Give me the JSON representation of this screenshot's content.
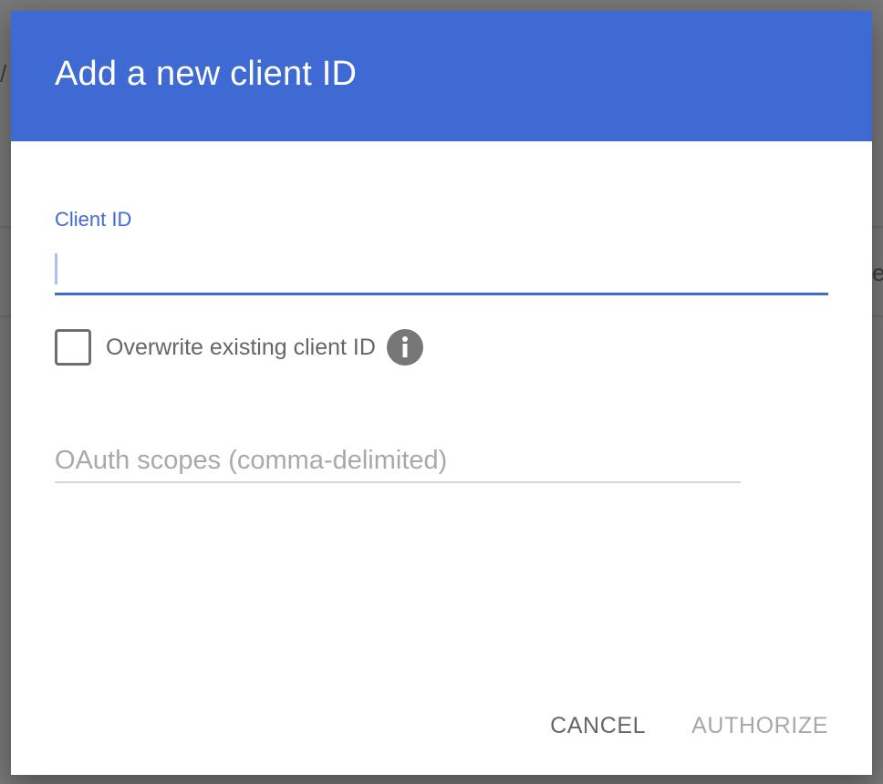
{
  "background": {
    "fragment_left": "/",
    "fragment_right": "es"
  },
  "dialog": {
    "title": "Add a new client ID",
    "header_color": "#3f6ad4",
    "client_id": {
      "label": "Client ID",
      "value": "",
      "placeholder": ""
    },
    "overwrite": {
      "label": "Overwrite existing client ID",
      "checked": false,
      "info_icon": "info-icon"
    },
    "scopes": {
      "value": "",
      "placeholder": "OAuth scopes (comma-delimited)"
    },
    "actions": {
      "cancel_label": "CANCEL",
      "authorize_label": "AUTHORIZE"
    }
  }
}
